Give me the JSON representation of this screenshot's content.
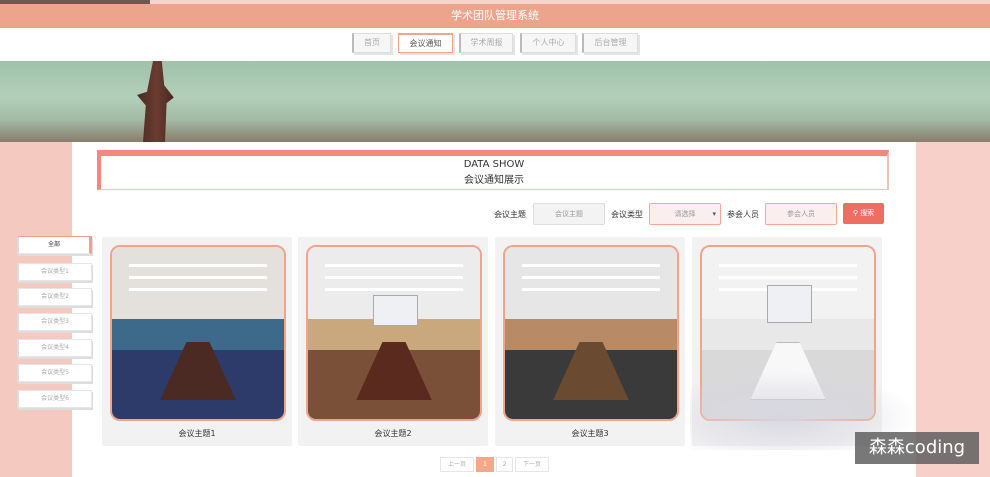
{
  "app": {
    "title": "学术团队管理系统"
  },
  "nav": {
    "items": [
      {
        "label": "首页"
      },
      {
        "label": "会议通知"
      },
      {
        "label": "学术周报"
      },
      {
        "label": "个人中心"
      },
      {
        "label": "后台管理"
      }
    ],
    "active": "会议通知"
  },
  "section": {
    "title_en": "DATA SHOW",
    "title_cn": "会议通知展示"
  },
  "search": {
    "topic_label": "会议主题",
    "topic_placeholder": "会议主题",
    "type_label": "会议类型",
    "type_value": "请选择",
    "attendee_label": "参会人员",
    "attendee_placeholder": "参会人员",
    "button_label": "搜索"
  },
  "categories": [
    {
      "label": "全部"
    },
    {
      "label": "会议类型1"
    },
    {
      "label": "会议类型2"
    },
    {
      "label": "会议类型3"
    },
    {
      "label": "会议类型4"
    },
    {
      "label": "会议类型5"
    },
    {
      "label": "会议类型6"
    }
  ],
  "cards": [
    {
      "title": "会议主题1"
    },
    {
      "title": "会议主题2"
    },
    {
      "title": "会议主题3"
    },
    {
      "title": ""
    }
  ],
  "pagination": {
    "prev": "上一页",
    "pages": [
      "1",
      "2"
    ],
    "next": "下一页",
    "current": "1"
  },
  "watermark": "森森coding",
  "colors": {
    "accent": "#eda48c",
    "button": "#ef6e64",
    "side": "#f4c9c0"
  }
}
